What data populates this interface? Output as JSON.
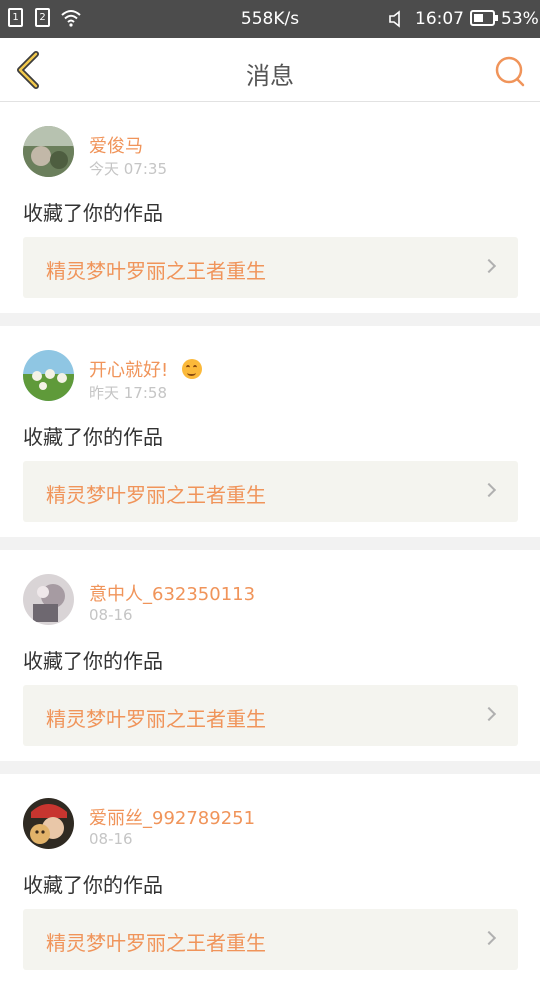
{
  "status_bar": {
    "sim1": "1",
    "sim2": "2",
    "net_speed": "558K/s",
    "mute_icon": "✕",
    "time": "16:07",
    "battery": "53%",
    "battery_level": 0.53
  },
  "header": {
    "title": "消息",
    "accent_color": "#f0945a"
  },
  "messages": [
    {
      "user": "爱俊马",
      "emoji": "",
      "time": "今天 07:35",
      "action": "收藏了你的作品",
      "work_title": "精灵梦叶罗丽之王者重生"
    },
    {
      "user": "开心就好!",
      "emoji": "smiling-face",
      "time": "昨天 17:58",
      "action": "收藏了你的作品",
      "work_title": "精灵梦叶罗丽之王者重生"
    },
    {
      "user": "意中人_632350113",
      "emoji": "",
      "time": "08-16",
      "action": "收藏了你的作品",
      "work_title": "精灵梦叶罗丽之王者重生"
    },
    {
      "user": "爱丽丝_992789251",
      "emoji": "",
      "time": "08-16",
      "action": "收藏了你的作品",
      "work_title": "精灵梦叶罗丽之王者重生"
    }
  ]
}
